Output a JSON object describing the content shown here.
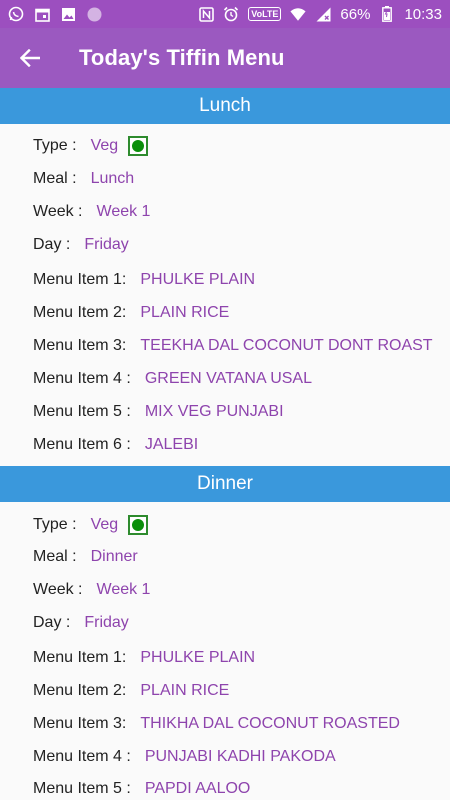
{
  "status_bar": {
    "battery": "66%",
    "time": "10:33",
    "network_badge": "VoLTE",
    "icons": [
      "whatsapp-icon",
      "calendar-icon",
      "image-icon",
      "circle-icon",
      "nfc-icon",
      "alarm-icon",
      "wifi-icon",
      "signal-icon",
      "battery-icon"
    ]
  },
  "app_bar": {
    "title": "Today's Tiffin Menu"
  },
  "lunch": {
    "header": "Lunch",
    "type_label": "Type :",
    "type_value": "Veg",
    "meal_label": "Meal :",
    "meal_value": "Lunch",
    "week_label": "Week :",
    "week_value": "Week 1",
    "day_label": "Day :",
    "day_value": "Friday",
    "items": [
      {
        "label": "Menu Item 1:",
        "value": "PHULKE PLAIN"
      },
      {
        "label": "Menu Item 2:",
        "value": "PLAIN RICE"
      },
      {
        "label": "Menu Item 3:",
        "value": "TEEKHA DAL COCONUT DONT ROAST"
      },
      {
        "label": "Menu Item 4 :",
        "value": "GREEN VATANA USAL"
      },
      {
        "label": "Menu Item 5 :",
        "value": "MIX VEG PUNJABI"
      },
      {
        "label": "Menu Item 6 :",
        "value": "JALEBI"
      }
    ]
  },
  "dinner": {
    "header": "Dinner",
    "type_label": "Type :",
    "type_value": "Veg",
    "meal_label": "Meal :",
    "meal_value": "Dinner",
    "week_label": "Week :",
    "week_value": "Week 1",
    "day_label": "Day :",
    "day_value": "Friday",
    "items": [
      {
        "label": "Menu Item 1:",
        "value": "PHULKE PLAIN"
      },
      {
        "label": "Menu Item 2:",
        "value": "PLAIN RICE"
      },
      {
        "label": "Menu Item 3:",
        "value": "THIKHA DAL COCONUT ROASTED"
      },
      {
        "label": "Menu Item 4 :",
        "value": "PUNJABI KADHI PAKODA"
      },
      {
        "label": "Menu Item 5 :",
        "value": "PAPDI AALOO"
      }
    ]
  },
  "colors": {
    "status_bar": "#9c4fbf",
    "app_bar": "#9b59c0",
    "section_header": "#3a98dc",
    "value_text": "#8e44ad",
    "veg_green": "#0b8f0b"
  }
}
